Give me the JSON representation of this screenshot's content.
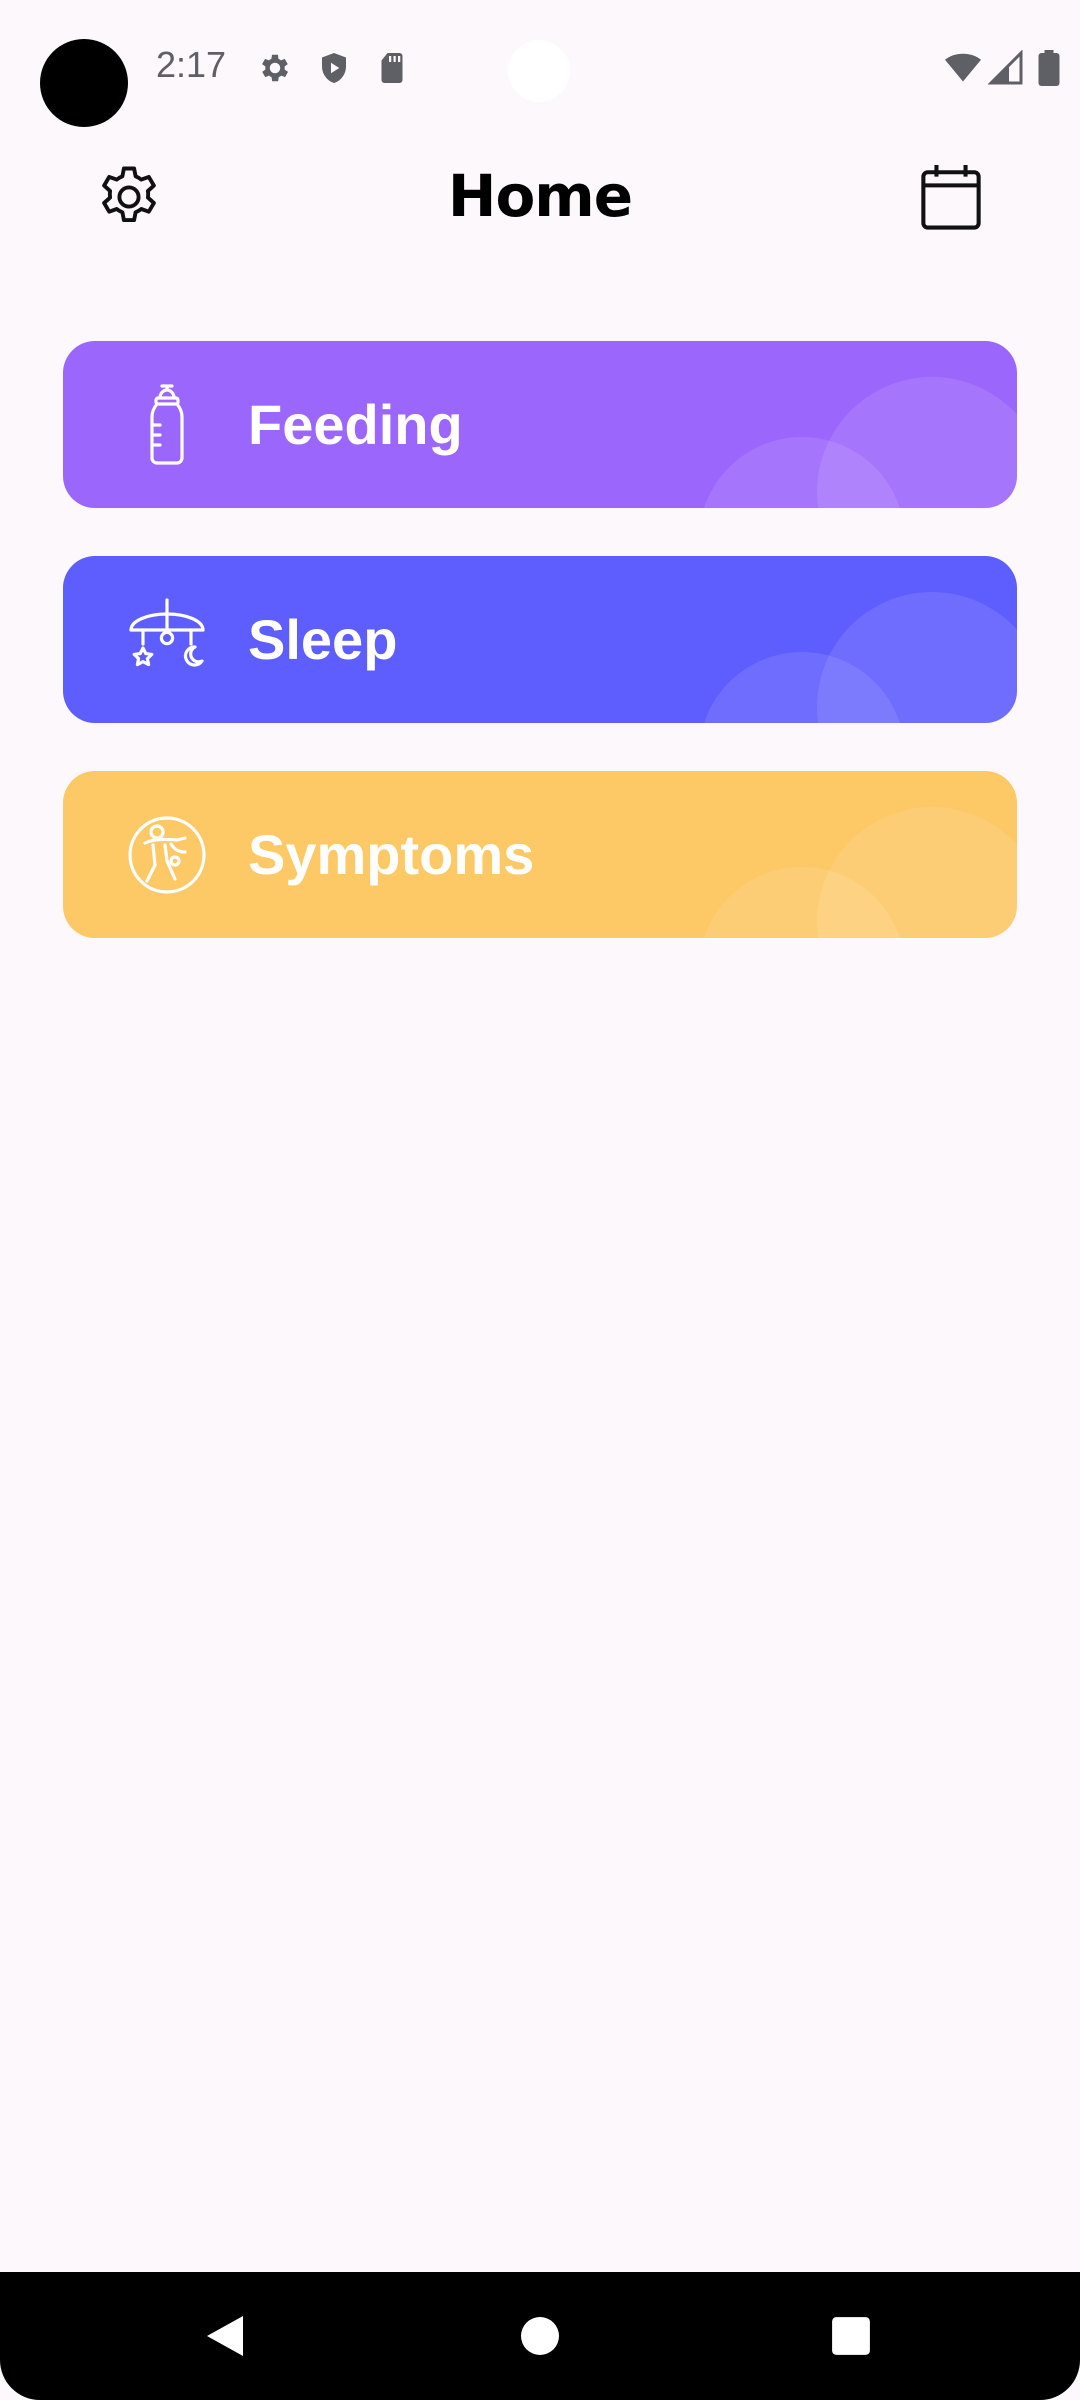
{
  "status_bar": {
    "time": "2:17",
    "icons": [
      "settings-icon",
      "shield-play-icon",
      "sd-card-icon",
      "wifi-icon",
      "signal-icon",
      "battery-icon"
    ]
  },
  "app_bar": {
    "title": "Home",
    "left_icon": "settings-gear-icon",
    "right_icon": "calendar-icon"
  },
  "categories": [
    {
      "label": "Feeding",
      "icon": "baby-bottle-icon",
      "color": "#9b66fc"
    },
    {
      "label": "Sleep",
      "icon": "crib-mobile-icon",
      "color": "#5e5dfd"
    },
    {
      "label": "Symptoms",
      "icon": "baby-symptoms-icon",
      "color": "#fdc866"
    }
  ],
  "nav_bar": {
    "icons": [
      "back-icon",
      "home-icon",
      "recents-icon"
    ]
  }
}
